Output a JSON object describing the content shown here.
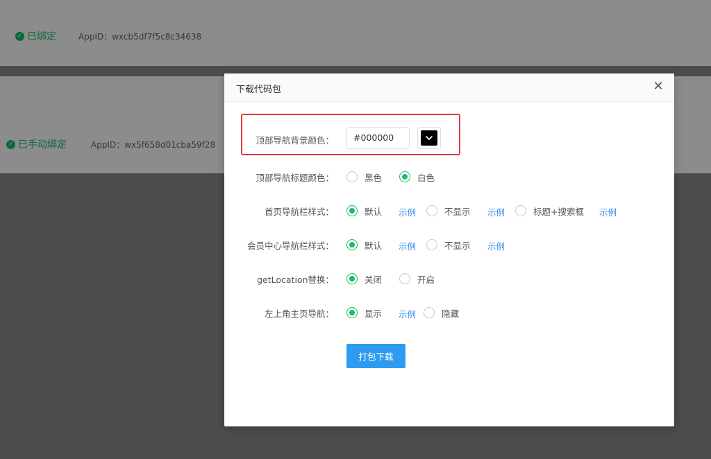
{
  "background": {
    "row1": {
      "status": "已绑定",
      "appid": "AppID：wxcb5df7f5c8c34638"
    },
    "row2": {
      "status": "已手动绑定",
      "appid": "AppID：wx5f658d01cba59f28"
    }
  },
  "modal": {
    "title": "下载代码包",
    "close_icon": "close-icon",
    "fields": {
      "nav_bg_color": {
        "label": "顶部导航背景颜色：",
        "value": "#000000",
        "swatch_color": "#000000"
      },
      "nav_title_color": {
        "label": "顶部导航标题颜色：",
        "options": [
          "黑色",
          "白色"
        ],
        "selected": "白色"
      },
      "home_nav_style": {
        "label": "首页导航栏样式：",
        "options": [
          "默认",
          "不显示",
          "标题+搜索框"
        ],
        "selected": "默认",
        "example": "示例"
      },
      "member_nav_style": {
        "label": "会员中心导航栏样式：",
        "options": [
          "默认",
          "不显示"
        ],
        "selected": "默认",
        "example": "示例"
      },
      "getlocation": {
        "label": "getLocation替换：",
        "options": [
          "关闭",
          "开启"
        ],
        "selected": "关闭"
      },
      "home_nav_top_left": {
        "label": "左上角主页导航：",
        "options": [
          "显示",
          "隐藏"
        ],
        "selected": "显示",
        "example": "示例"
      }
    },
    "submit_label": "打包下载"
  },
  "colors": {
    "accent_green": "#19be6b",
    "link_blue": "#2d8cf0",
    "button_blue": "#2d9cf0",
    "highlight_red": "#e03a3a"
  }
}
